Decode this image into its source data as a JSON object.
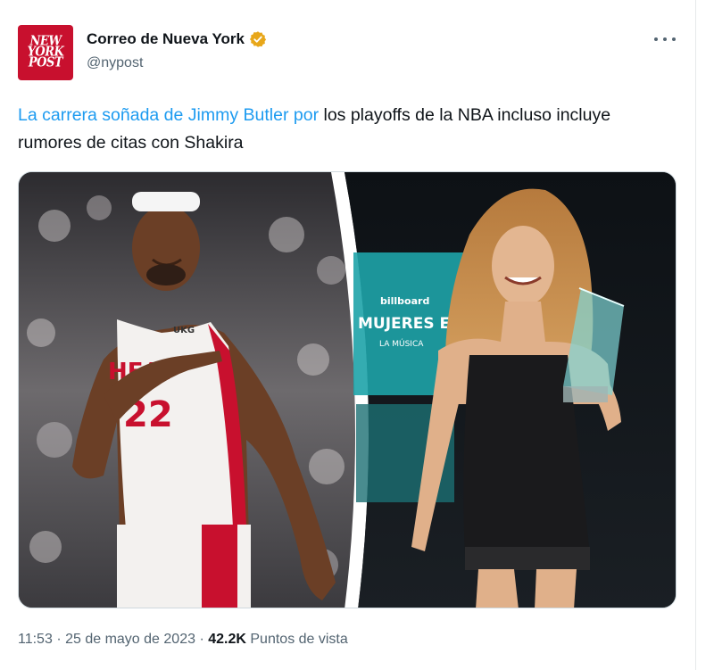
{
  "account": {
    "avatar_lines": [
      "NEW",
      "YORK",
      "POST"
    ],
    "display_name": "Correo de Nueva York",
    "handle": "@nypost",
    "verified_icon": "gold-verified-badge",
    "more_icon": "more-dots-icon"
  },
  "tweet": {
    "link_text": "La carrera soñada de Jimmy Butler por",
    "text_rest": " los playoffs de la NBA incluso incluye rumores de citas con Shakira"
  },
  "media": {
    "left_jersey_text": "HEAT",
    "left_jersey_number": "22",
    "left_brand": "UKG",
    "right_backdrop_brand": "billboard",
    "right_backdrop_text": "MUJERES EN",
    "right_backdrop_sub": "LA MÚSICA"
  },
  "meta": {
    "time": "11:53",
    "date": "25 de mayo de 2023",
    "separator": "·",
    "views_count": "42.2K",
    "views_label": "Puntos de vista"
  },
  "colors": {
    "link": "#1d9bf0",
    "secondary_text": "#536471",
    "avatar_bg": "#c8102e",
    "verified": "#e8a71a"
  }
}
